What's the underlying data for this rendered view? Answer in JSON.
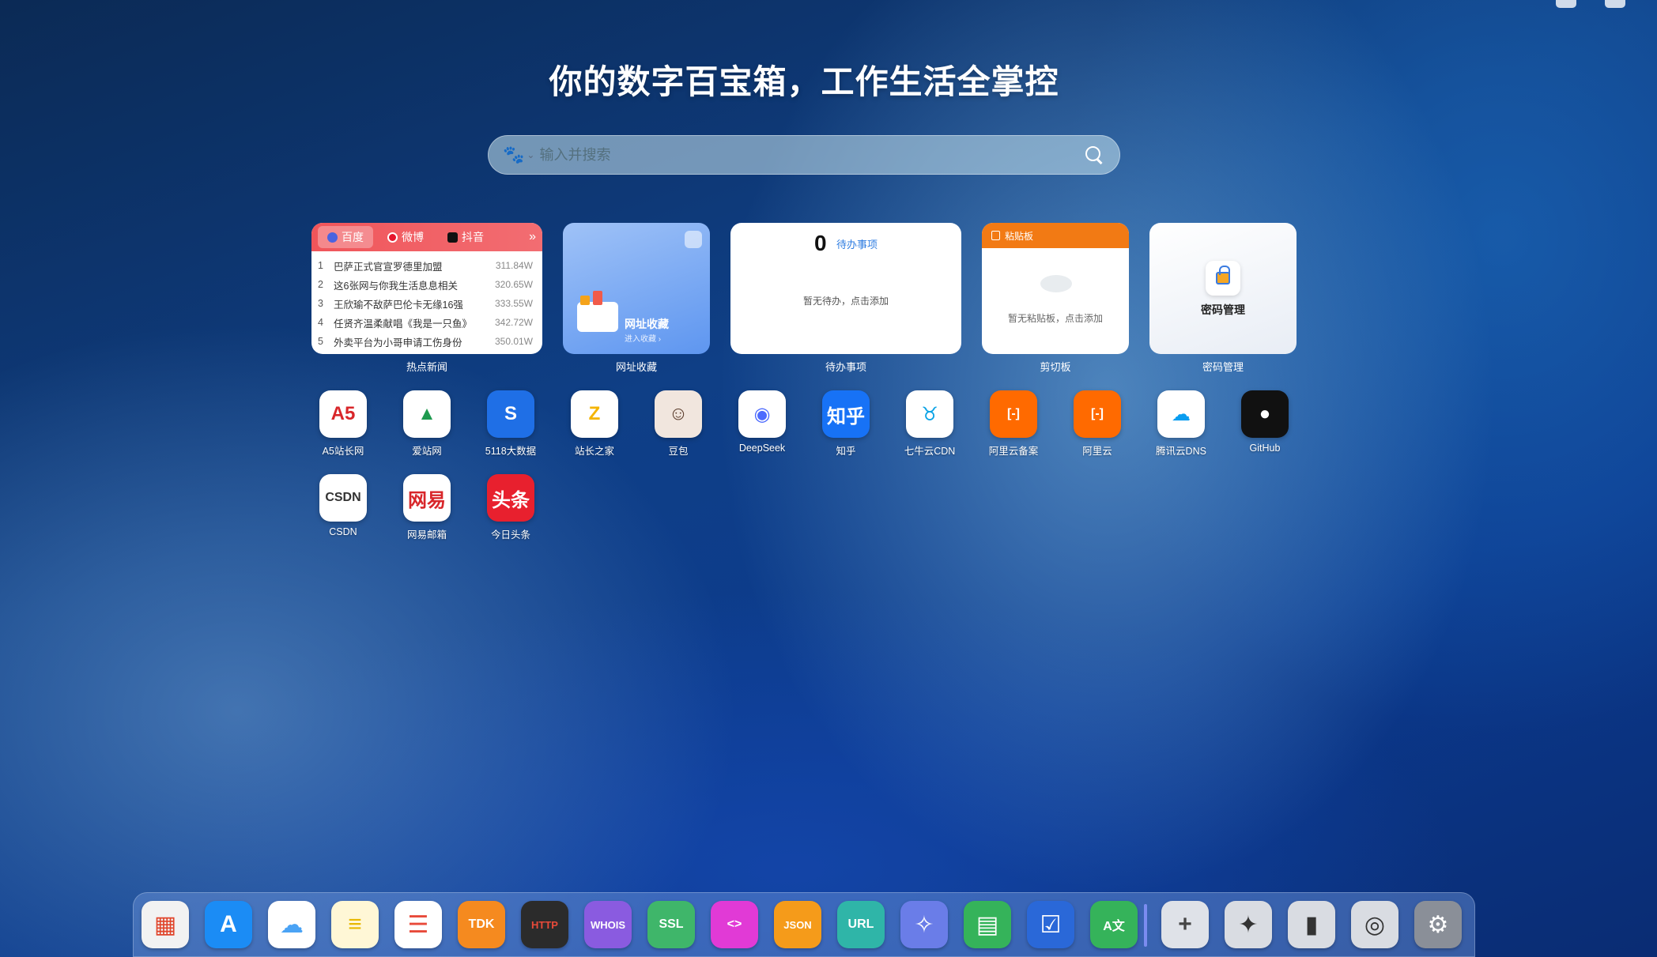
{
  "headline": "你的数字百宝箱，工作生活全掌控",
  "search": {
    "placeholder": "输入并搜索"
  },
  "widgets": {
    "news": {
      "tabs": [
        "百度",
        "微博",
        "抖音"
      ],
      "items": [
        {
          "rank": "1",
          "title": "巴萨正式官宣罗德里加盟",
          "value": "311.84W"
        },
        {
          "rank": "2",
          "title": "这6张网与你我生活息息相关",
          "value": "320.65W"
        },
        {
          "rank": "3",
          "title": "王欣瑜不敌萨巴伦卡无缘16强",
          "value": "333.55W"
        },
        {
          "rank": "4",
          "title": "任贤齐温柔献唱《我是一只鱼》",
          "value": "342.72W"
        },
        {
          "rank": "5",
          "title": "外卖平台为小哥申请工伤身份",
          "value": "350.01W"
        }
      ],
      "label": "热点新闻"
    },
    "bookmark": {
      "title": "网址收藏",
      "subtitle": "进入收藏 ›",
      "label": "网址收藏"
    },
    "todo": {
      "count": "0",
      "title": "待办事项",
      "empty": "暂无待办，点击添加",
      "label": "待办事项"
    },
    "clipboard": {
      "title": "粘贴板",
      "empty": "暂无粘贴板，点击添加",
      "label": "剪切板"
    },
    "password": {
      "title": "密码管理",
      "label": "密码管理"
    }
  },
  "apps": [
    {
      "label": "A5站长网",
      "icon": "A5",
      "bg": "#ffffff",
      "fg": "#d8262a"
    },
    {
      "label": "爱站网",
      "icon": "▲",
      "bg": "#ffffff",
      "fg": "#1e9a4f"
    },
    {
      "label": "5118大数据",
      "icon": "S",
      "bg": "#1f6fe6",
      "fg": "#ffffff"
    },
    {
      "label": "站长之家",
      "icon": "Z",
      "bg": "#ffffff",
      "fg": "#f4b400"
    },
    {
      "label": "豆包",
      "icon": "☺",
      "bg": "#f1e6de",
      "fg": "#5a3c2c"
    },
    {
      "label": "DeepSeek",
      "icon": "◉",
      "bg": "#ffffff",
      "fg": "#4d6bfe"
    },
    {
      "label": "知乎",
      "icon": "知乎",
      "bg": "#1772f6",
      "fg": "#ffffff"
    },
    {
      "label": "七牛云CDN",
      "icon": "♉",
      "bg": "#ffffff",
      "fg": "#0aa3e6"
    },
    {
      "label": "阿里云备案",
      "icon": "[-]",
      "bg": "#ff6a00",
      "fg": "#ffffff"
    },
    {
      "label": "阿里云",
      "icon": "[-]",
      "bg": "#ff6a00",
      "fg": "#ffffff"
    },
    {
      "label": "腾讯云DNS",
      "icon": "☁",
      "bg": "#ffffff",
      "fg": "#0a9df0"
    },
    {
      "label": "GitHub",
      "icon": "●",
      "bg": "#111111",
      "fg": "#ffffff"
    },
    {
      "label": "CSDN",
      "icon": "CSDN",
      "bg": "#ffffff",
      "fg": "#333333"
    },
    {
      "label": "网易邮箱",
      "icon": "网易",
      "bg": "#ffffff",
      "fg": "#d8262a"
    },
    {
      "label": "今日头条",
      "icon": "头条",
      "bg": "#e8202e",
      "fg": "#ffffff"
    }
  ],
  "dock": [
    {
      "name": "launchpad",
      "icon": "▦",
      "bg": "#f2f2f2",
      "fg": "#e0442a"
    },
    {
      "name": "app-store",
      "icon": "A",
      "bg": "#1b8cf5",
      "fg": "#ffffff"
    },
    {
      "name": "icloud",
      "icon": "☁",
      "bg": "#ffffff",
      "fg": "#4aa3f5"
    },
    {
      "name": "notes",
      "icon": "≡",
      "bg": "#fff7d6",
      "fg": "#e8b800"
    },
    {
      "name": "reminders",
      "icon": "☰",
      "bg": "#ffffff",
      "fg": "#e84a3a"
    },
    {
      "name": "tdk",
      "icon": "TDK",
      "bg": "#f58a1f",
      "fg": "#ffffff"
    },
    {
      "name": "http-header",
      "icon": "HTTP",
      "bg": "#2b2b2b",
      "fg": "#e84a3a"
    },
    {
      "name": "whois",
      "icon": "WHOIS",
      "bg": "#8a5be0",
      "fg": "#ffffff"
    },
    {
      "name": "ssl",
      "icon": "SSL",
      "bg": "#3fb66a",
      "fg": "#ffffff"
    },
    {
      "name": "code",
      "icon": "<>",
      "bg": "#e13ad6",
      "fg": "#ffffff"
    },
    {
      "name": "json",
      "icon": "JSON",
      "bg": "#f59b1a",
      "fg": "#ffffff"
    },
    {
      "name": "url",
      "icon": "URL",
      "bg": "#2fb5a8",
      "fg": "#ffffff"
    },
    {
      "name": "image",
      "icon": "✧",
      "bg": "#6a7de8",
      "fg": "#ffffff"
    },
    {
      "name": "sheet",
      "icon": "▤",
      "bg": "#35b35a",
      "fg": "#ffffff"
    },
    {
      "name": "form",
      "icon": "☑",
      "bg": "#2a68d8",
      "fg": "#ffffff"
    },
    {
      "name": "translate",
      "icon": "A文",
      "bg": "#35b35a",
      "fg": "#ffffff"
    },
    {
      "name": "add",
      "icon": "+",
      "bg": "#dfe2e8",
      "fg": "#444444"
    },
    {
      "name": "plugins",
      "icon": "✦",
      "bg": "#d9dce2",
      "fg": "#333333"
    },
    {
      "name": "brush",
      "icon": "▮",
      "bg": "#d9dce2",
      "fg": "#333333"
    },
    {
      "name": "settings-toggle",
      "icon": "◎",
      "bg": "#d9dce2",
      "fg": "#333333"
    },
    {
      "name": "system-settings",
      "icon": "⚙",
      "bg": "#8a8f98",
      "fg": "#ffffff"
    }
  ]
}
